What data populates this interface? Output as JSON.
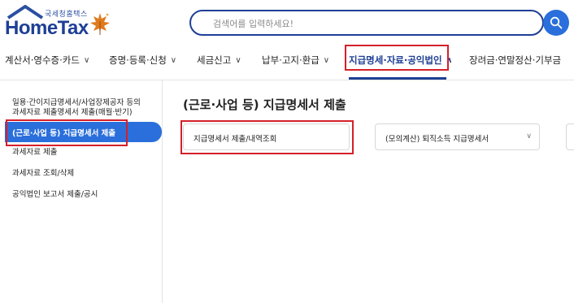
{
  "header": {
    "logo_small": "국세청홈택스",
    "logo_main": "HomeTax",
    "search_placeholder": "검색어를 입력하세요!"
  },
  "nav": {
    "items": [
      {
        "label": "계산서·영수증·카드"
      },
      {
        "label": "증명·등록·신청"
      },
      {
        "label": "세금신고"
      },
      {
        "label": "납부·고지·환급"
      },
      {
        "label": "지급명세·자료·공익법인"
      },
      {
        "label": "장려금·연말정산·기부금"
      }
    ],
    "active_index": 4
  },
  "sidebar": {
    "items": [
      {
        "label": "일용·간이지급명세서/사업장제공자 등의"
      },
      {
        "label": "과세자료 제출명세서 제출(매월·반기)"
      },
      {
        "label": "(근로·사업 등) 지급명세서 제출"
      },
      {
        "label": "과세자료 제출"
      },
      {
        "label": "과세자료 조회/삭제"
      },
      {
        "label": "공익법인 보고서 제출/공시"
      }
    ]
  },
  "main": {
    "title": "(근로·사업 등) 지급명세서 제출",
    "cards": [
      {
        "label": "지급명세서 제출/내역조회"
      },
      {
        "label": "(모의계산) 퇴직소득 지급명세서"
      }
    ]
  },
  "colors": {
    "brand": "#1e3f95",
    "accent": "#2a6fdb",
    "highlight": "#d4202a"
  }
}
